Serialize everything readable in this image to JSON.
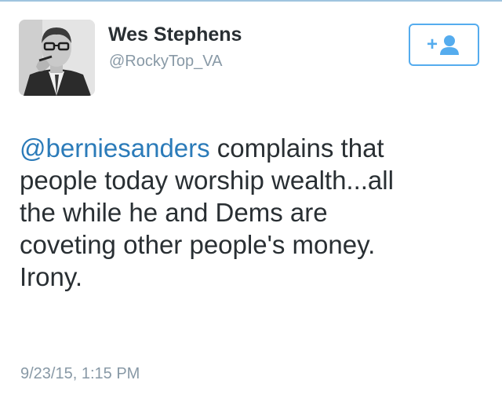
{
  "header": {
    "name": "Wes Stephens",
    "handle": "@RockyTop_VA"
  },
  "follow_button": {
    "icon": "add-user-icon",
    "plus": "+",
    "accent_color": "#55acee"
  },
  "tweet": {
    "mention": "@berniesanders",
    "lines": [
      " complains that",
      "people today worship wealth...all",
      "the while he and Dems are",
      "coveting other people's money.",
      "Irony."
    ],
    "mention_color": "#2b7bb9"
  },
  "timestamp": "9/23/15, 1:15 PM"
}
